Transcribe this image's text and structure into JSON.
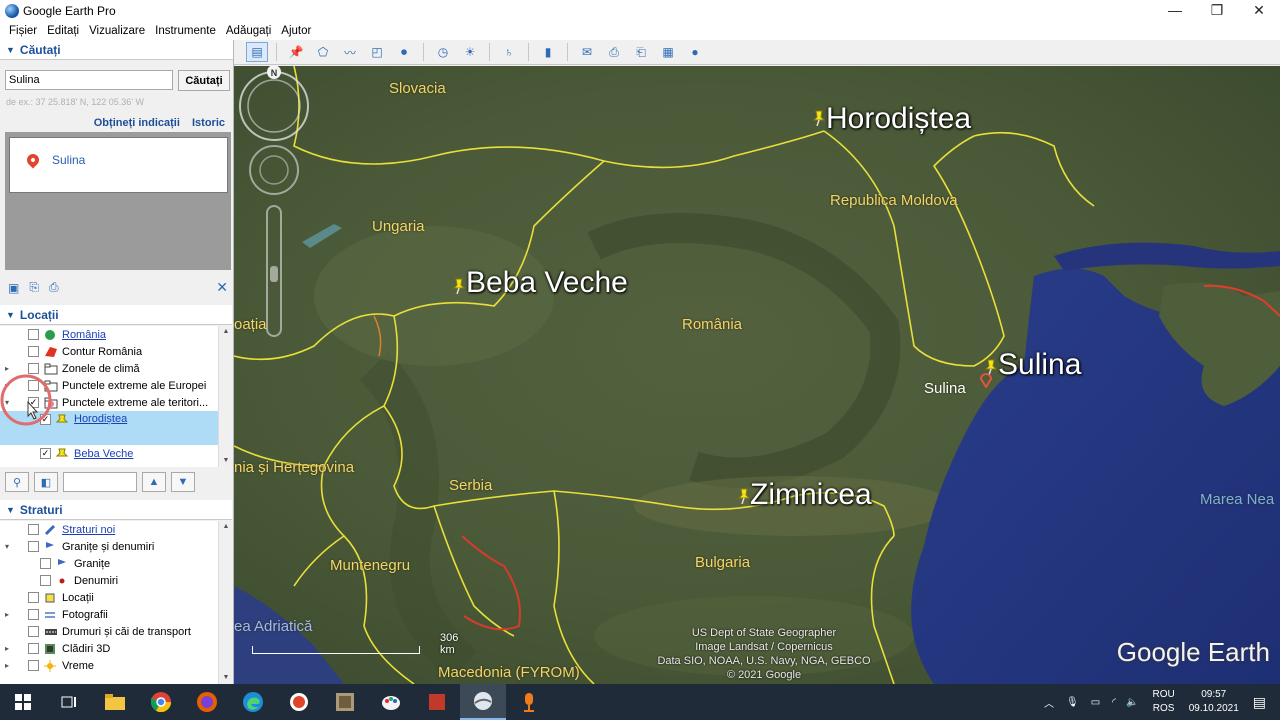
{
  "window": {
    "title": "Google Earth Pro",
    "controls": [
      "—",
      "❐",
      "✕"
    ]
  },
  "menu": [
    "Fișier",
    "Editați",
    "Vizualizare",
    "Instrumente",
    "Adăugați",
    "Ajutor"
  ],
  "search": {
    "section_title": "Căutați",
    "input_value": "Sulina",
    "button_label": "Căutați",
    "hint": "de ex.: 37 25.818' N, 122 05.36' W",
    "link_directions": "Obțineți indicații",
    "link_history": "Istoric",
    "result_label": "Sulina"
  },
  "places": {
    "section_title": "Locații",
    "items": [
      {
        "label": "România",
        "level": 1,
        "checked": false,
        "link": true,
        "expand": ""
      },
      {
        "label": "Contur România",
        "level": 1,
        "checked": false,
        "link": false,
        "expand": ""
      },
      {
        "label": "Zonele de climă",
        "level": 1,
        "checked": false,
        "link": false,
        "expand": "▸"
      },
      {
        "label": "Punctele extreme ale Europei",
        "level": 1,
        "checked": false,
        "link": false,
        "expand": "▸"
      },
      {
        "label": "Punctele extreme ale teritori...",
        "level": 1,
        "checked": true,
        "link": false,
        "expand": "▾"
      },
      {
        "label": "Horodiștea",
        "level": 2,
        "checked": true,
        "link": true,
        "expand": "",
        "selected": true
      },
      {
        "label": "Beba Veche",
        "level": 2,
        "checked": true,
        "link": true,
        "expand": ""
      }
    ]
  },
  "layers": {
    "section_title": "Straturi",
    "items": [
      {
        "label": "Straturi noi",
        "level": 1,
        "link": true,
        "expand": ""
      },
      {
        "label": "Granițe și denumiri",
        "level": 1,
        "link": false,
        "expand": "▾"
      },
      {
        "label": "Granițe",
        "level": 2,
        "link": false,
        "expand": ""
      },
      {
        "label": "Denumiri",
        "level": 2,
        "link": false,
        "expand": ""
      },
      {
        "label": "Locații",
        "level": 1,
        "link": false,
        "expand": ""
      },
      {
        "label": "Fotografii",
        "level": 1,
        "link": false,
        "expand": "▸"
      },
      {
        "label": "Drumuri și căi de transport",
        "level": 1,
        "link": false,
        "expand": ""
      },
      {
        "label": "Clădiri 3D",
        "level": 1,
        "link": false,
        "expand": "▸"
      },
      {
        "label": "Vreme",
        "level": 1,
        "link": false,
        "expand": "▸"
      }
    ]
  },
  "map": {
    "country_labels": [
      "Slovacia",
      "Ungaria",
      "România",
      "Republica Moldova",
      "oația",
      "nia și Herțegovina",
      "Serbia",
      "Bulgaria",
      "Muntenegru",
      "ea Adriatică",
      "Macedonia (FYROM)",
      "Marea Nea",
      "Sulina"
    ],
    "placemarks": [
      "Horodiștea",
      "Beba Veche",
      "Sulina",
      "Zimnicea"
    ],
    "scale_label": "306 km",
    "credits": [
      "US Dept of State Geographer",
      "Image Landsat / Copernicus",
      "Data SIO, NOAA, U.S. Navy, NGA, GEBCO",
      "© 2021 Google"
    ],
    "brand": "Google Earth",
    "compass_letter": "N"
  },
  "taskbar": {
    "lang_top": "ROU",
    "lang_bottom": "ROS",
    "time": "09:57",
    "date": "09.10.2021"
  }
}
